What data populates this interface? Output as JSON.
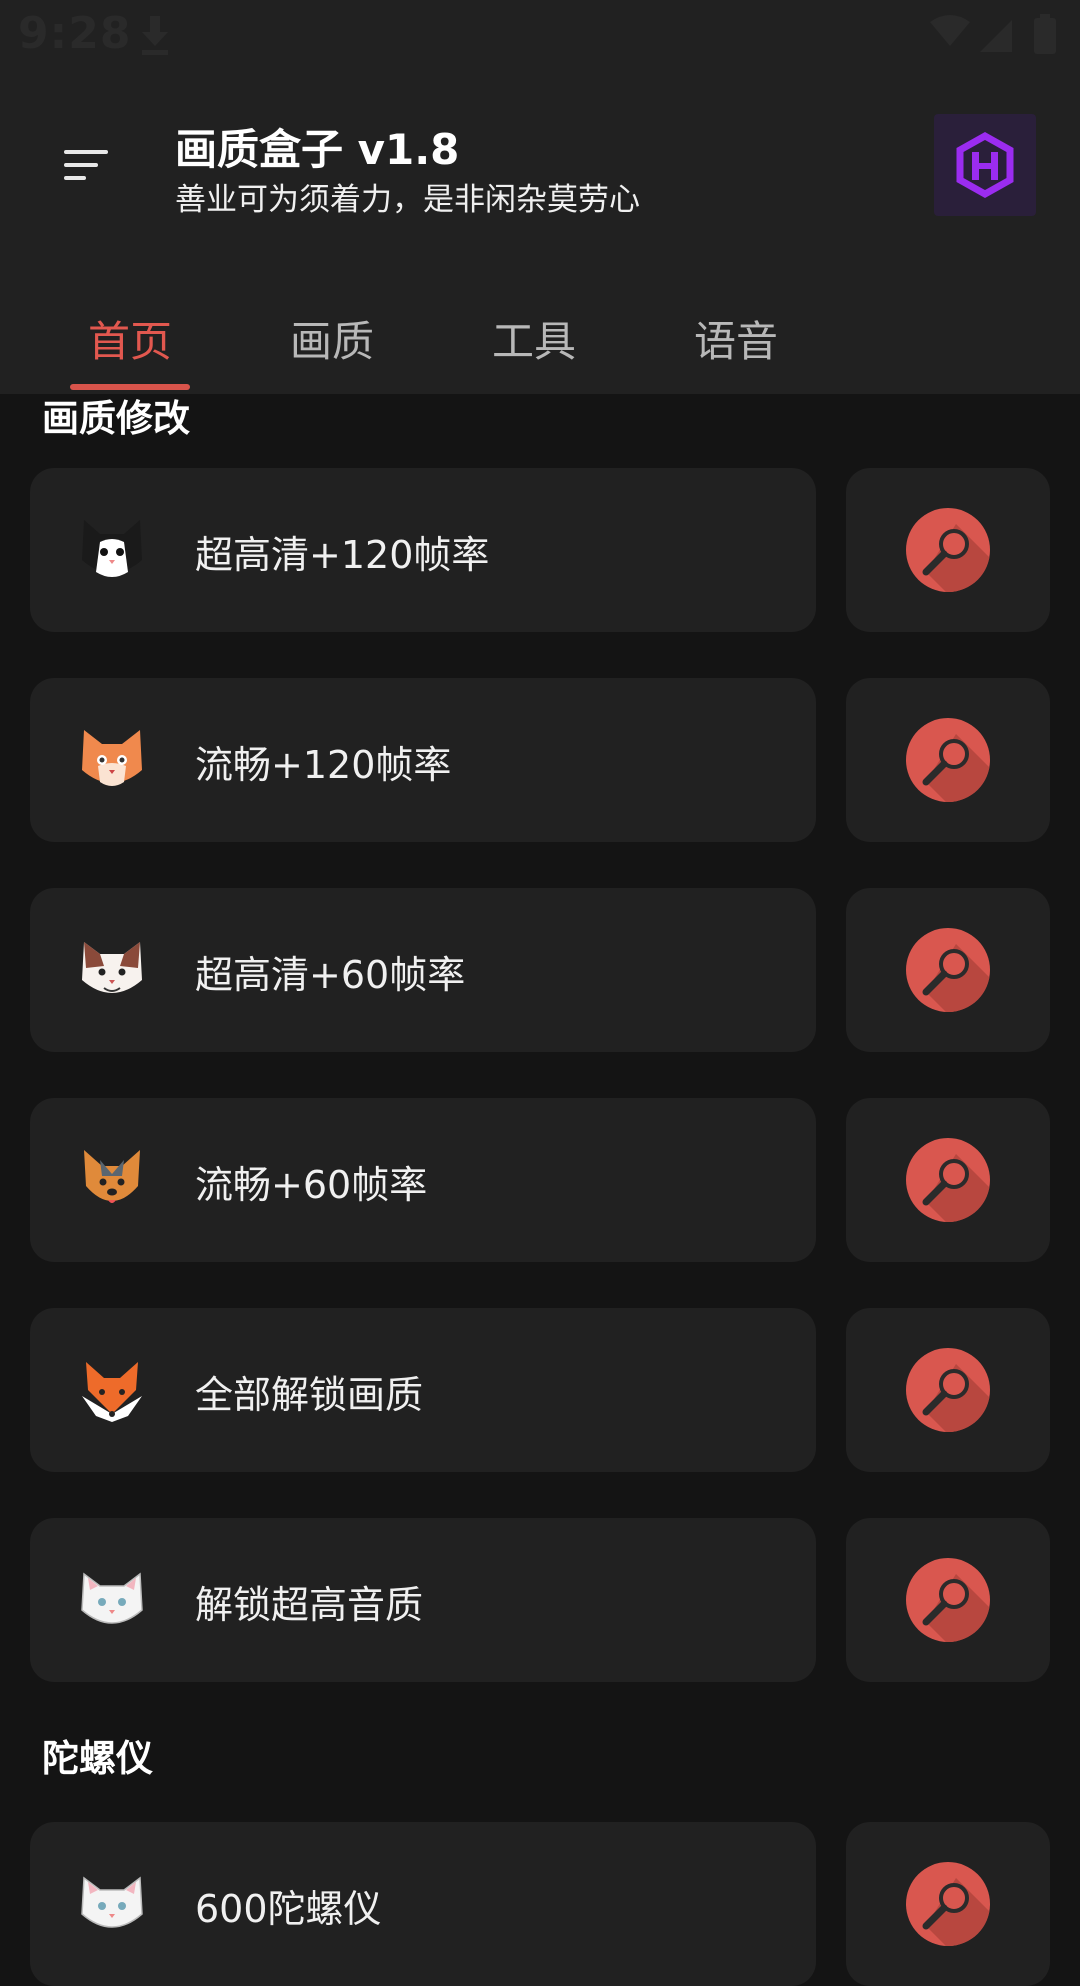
{
  "status_bar": {
    "time": "9:28"
  },
  "header": {
    "title": "画质盒子 v1.8",
    "subtitle": "善业可为须着力，是非闲杂莫劳心"
  },
  "tabs": [
    {
      "label": "首页",
      "active": true
    },
    {
      "label": "画质",
      "active": false
    },
    {
      "label": "工具",
      "active": false
    },
    {
      "label": "语音",
      "active": false
    }
  ],
  "sections": [
    {
      "title": "画质修改",
      "items": [
        {
          "label": "超高清+120帧率",
          "icon": "black-white-cat-icon"
        },
        {
          "label": "流畅+120帧率",
          "icon": "orange-cat-icon"
        },
        {
          "label": "超高清+60帧率",
          "icon": "calico-cat-icon"
        },
        {
          "label": "流畅+60帧率",
          "icon": "terrier-dog-icon"
        },
        {
          "label": "全部解锁画质",
          "icon": "fox-icon"
        },
        {
          "label": "解锁超高音质",
          "icon": "white-cat-icon"
        }
      ]
    },
    {
      "title": "陀螺仪",
      "items": [
        {
          "label": "600陀螺仪",
          "icon": "white-cat-icon"
        }
      ]
    }
  ],
  "colors": {
    "accent": "#d9544b",
    "background": "#141414",
    "surface": "#212121"
  }
}
